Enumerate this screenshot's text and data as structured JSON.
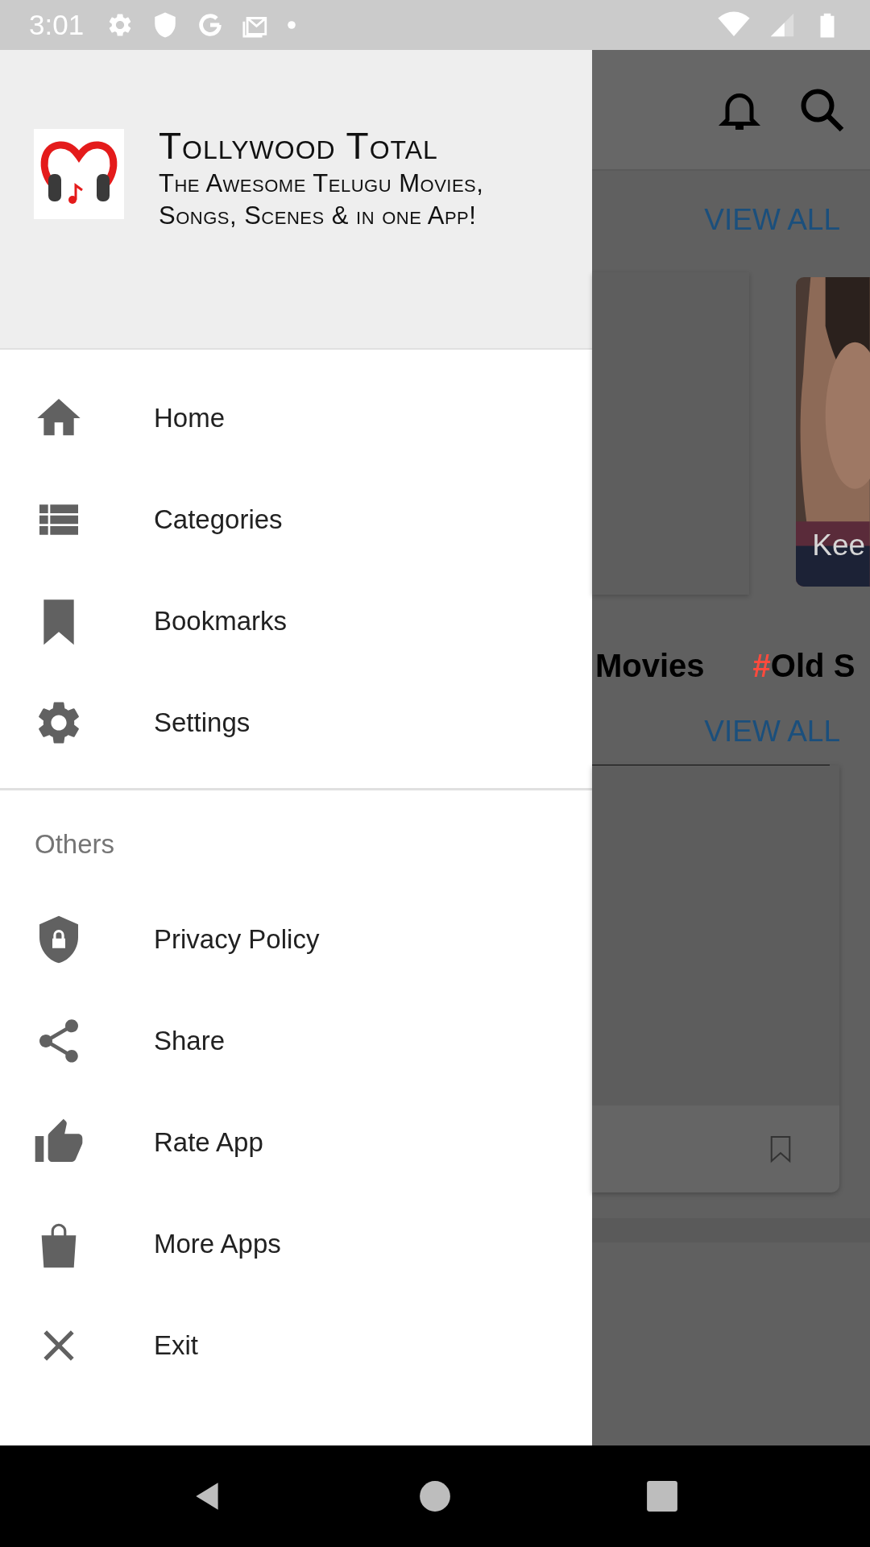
{
  "status_bar": {
    "time": "3:01"
  },
  "drawer": {
    "app_title": "Tollywood Total",
    "app_subtitle": "The Awesome Telugu Movies, Songs, Scenes & in one App!",
    "main_items": [
      {
        "label": "Home"
      },
      {
        "label": "Categories"
      },
      {
        "label": "Bookmarks"
      },
      {
        "label": "Settings"
      }
    ],
    "section_title": "Others",
    "other_items": [
      {
        "label": "Privacy Policy"
      },
      {
        "label": "Share"
      },
      {
        "label": "Rate App"
      },
      {
        "label": "More Apps"
      },
      {
        "label": "Exit"
      }
    ]
  },
  "background": {
    "view_all_top": "VIEW ALL",
    "card_caption": "Kee",
    "tags": [
      {
        "text": "Movies"
      },
      {
        "hash": "#",
        "text": "Old S"
      }
    ],
    "view_all_bottom": "VIEW ALL"
  }
}
